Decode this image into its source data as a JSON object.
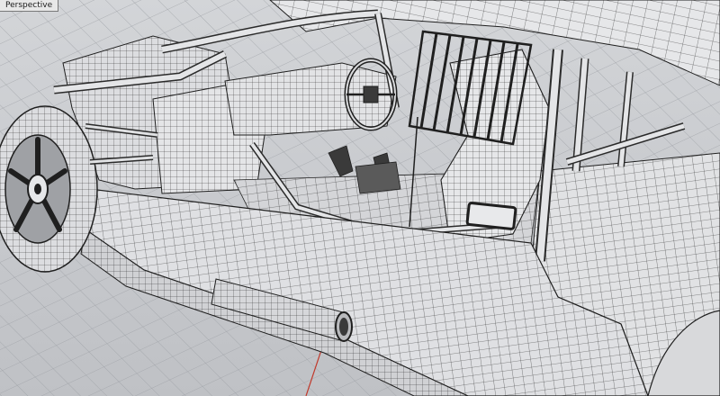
{
  "viewport": {
    "label": "Perspective",
    "projection": "perspective",
    "display_mode": "wireframe",
    "background_color": "#c9cbcf",
    "grid_color": "#9ea1a6",
    "wire_color": "#1f1f1f",
    "surface_color": "#e3e4e6",
    "axis_color_x": "#c0392b"
  }
}
